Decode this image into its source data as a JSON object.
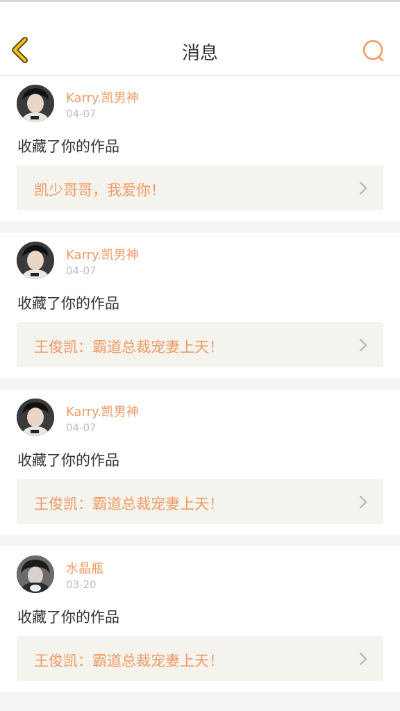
{
  "header": {
    "title": "消息",
    "back_icon": "chevron-left-icon",
    "search_icon": "search-icon",
    "accent_color": "#f19a63",
    "back_color": "#f5c518"
  },
  "messages": [
    {
      "user": "Karry.凯男神",
      "date": "04-07",
      "action": "收藏了你的作品",
      "work_title": "凯少哥哥，我爱你！"
    },
    {
      "user": "Karry.凯男神",
      "date": "04-07",
      "action": "收藏了你的作品",
      "work_title": "王俊凯：霸道总裁宠妻上天！"
    },
    {
      "user": "Karry.凯男神",
      "date": "04-07",
      "action": "收藏了你的作品",
      "work_title": "王俊凯：霸道总裁宠妻上天！"
    },
    {
      "user": "水晶瓶",
      "date": "03-20",
      "action": "收藏了你的作品",
      "work_title": "王俊凯：霸道总裁宠妻上天！"
    }
  ]
}
